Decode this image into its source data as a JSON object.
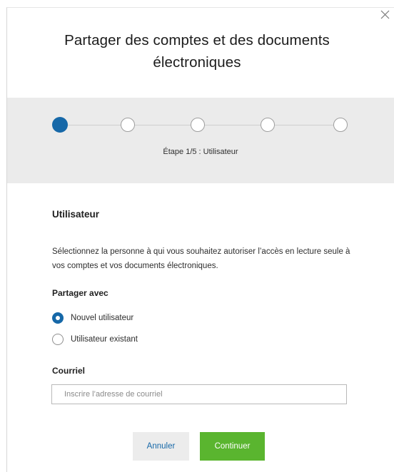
{
  "modal": {
    "title": "Partager des comptes et des documents électroniques",
    "close_icon": "close-icon"
  },
  "stepper": {
    "steps": [
      {
        "state": "active"
      },
      {
        "state": "inactive"
      },
      {
        "state": "inactive"
      },
      {
        "state": "inactive"
      },
      {
        "state": "inactive"
      }
    ],
    "current_step": 1,
    "total_steps": 5,
    "label": "Étape 1/5 : Utilisateur",
    "active_color": "#1668a8"
  },
  "form": {
    "section_title": "Utilisateur",
    "description": "Sélectionnez la personne à qui vous souhaitez autoriser l’accès en lecture seule à vos comptes et vos documents électroniques.",
    "share_with_label": "Partager avec",
    "options": [
      {
        "label": "Nouvel utilisateur",
        "selected": true
      },
      {
        "label": "Utilisateur existant",
        "selected": false
      }
    ],
    "email_label": "Courriel",
    "email_placeholder": "Inscrire l’adresse de courriel",
    "email_value": ""
  },
  "actions": {
    "cancel_label": "Annuler",
    "continue_label": "Continuer",
    "continue_color": "#5ab52f",
    "cancel_text_color": "#1668a8"
  }
}
